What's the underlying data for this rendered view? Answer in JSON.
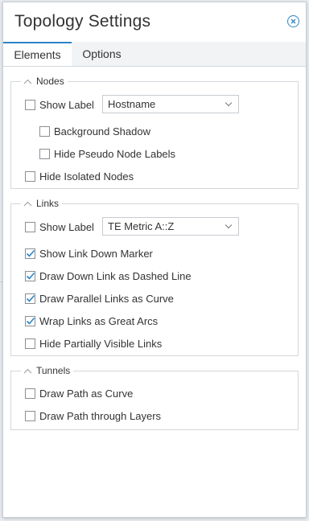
{
  "title": "Topology Settings",
  "close_icon": "close-circle-icon",
  "tabs": [
    {
      "label": "Elements",
      "active": true
    },
    {
      "label": "Options",
      "active": false
    }
  ],
  "groups": {
    "nodes": {
      "label": "Nodes",
      "show_label": {
        "label": "Show Label",
        "checked": false
      },
      "label_select": {
        "value": "Hostname"
      },
      "background_shadow": {
        "label": "Background Shadow",
        "checked": false
      },
      "hide_pseudo": {
        "label": "Hide Pseudo Node Labels",
        "checked": false
      },
      "hide_isolated": {
        "label": "Hide Isolated Nodes",
        "checked": false
      }
    },
    "links": {
      "label": "Links",
      "show_label": {
        "label": "Show Label",
        "checked": false
      },
      "label_select": {
        "value": "TE Metric A::Z"
      },
      "show_link_down": {
        "label": "Show Link Down Marker",
        "checked": true
      },
      "draw_down_dashed": {
        "label": "Draw Down Link as Dashed Line",
        "checked": true
      },
      "draw_parallel_curve": {
        "label": "Draw Parallel Links as Curve",
        "checked": true
      },
      "wrap_great_arcs": {
        "label": "Wrap Links as Great Arcs",
        "checked": true
      },
      "hide_partial": {
        "label": "Hide Partially Visible Links",
        "checked": false
      }
    },
    "tunnels": {
      "label": "Tunnels",
      "draw_path_curve": {
        "label": "Draw Path as Curve",
        "checked": false
      },
      "draw_path_layers": {
        "label": "Draw Path through Layers",
        "checked": false
      }
    }
  },
  "colors": {
    "accent": "#2b84c6",
    "border": "#d3d7db",
    "text": "#333333"
  }
}
